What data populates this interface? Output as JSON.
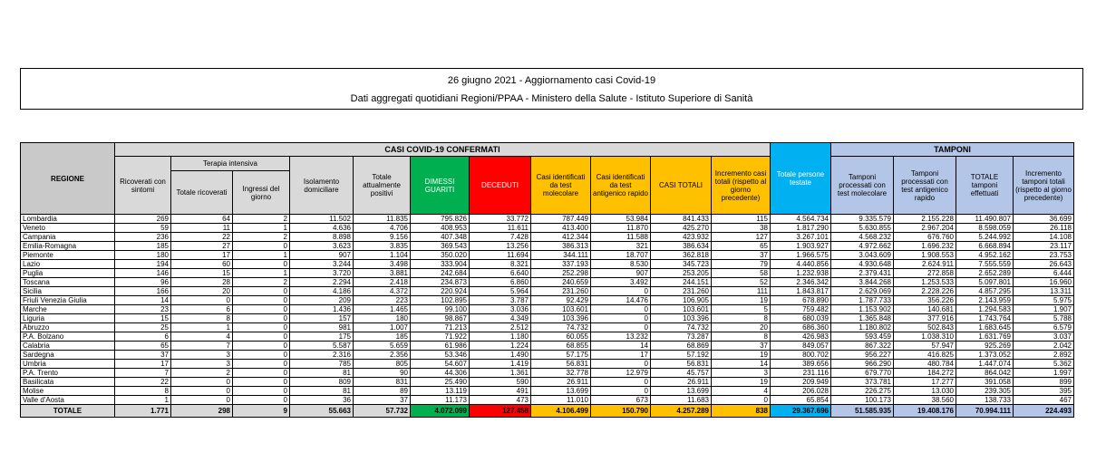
{
  "header": {
    "title": "26 giugno 2021 - Aggiornamento casi Covid-19",
    "subtitle": "Dati aggregati quotidiani Regioni/PPAA - Ministero della Salute - Istituto Superiore di Sanità"
  },
  "table": {
    "group_confirmed": "CASI COVID-19 CONFERMATI",
    "group_tamponi": "TAMPONI",
    "group_ti": "Terapia intensiva",
    "col_region": "REGIONE",
    "cols": [
      "Ricoverati con sintomi",
      "Totale ricoverati",
      "Ingressi del giorno",
      "Isolamento domiciliare",
      "Totale attualmente positivi",
      "DIMESSI GUARITI",
      "DECEDUTI",
      "Casi identificati da test molecolare",
      "Casi identificati da test antigenico rapido",
      "CASI TOTALI",
      "Incremento casi totali (rispetto al giorno precedente)",
      "Totale persone testate",
      "Tamponi processati con test molecolare",
      "Tamponi processati con test antigenico rapido",
      "TOTALE tamponi effettuati",
      "Incremento tamponi totali (rispetto al giorno precedente)"
    ],
    "rows": [
      [
        "Lombardia",
        "269",
        "64",
        "2",
        "11.502",
        "11.835",
        "795.826",
        "33.772",
        "787.449",
        "53.984",
        "841.433",
        "115",
        "4.564.734",
        "9.335.579",
        "2.155.228",
        "11.490.807",
        "36.699"
      ],
      [
        "Veneto",
        "59",
        "11",
        "1",
        "4.636",
        "4.706",
        "408.953",
        "11.611",
        "413.400",
        "11.870",
        "425.270",
        "38",
        "1.817.290",
        "5.630.855",
        "2.967.204",
        "8.598.059",
        "26.118"
      ],
      [
        "Campania",
        "236",
        "22",
        "2",
        "8.898",
        "9.156",
        "407.348",
        "7.428",
        "412.344",
        "11.588",
        "423.932",
        "127",
        "3.267.101",
        "4.568.232",
        "676.760",
        "5.244.992",
        "14.108"
      ],
      [
        "Emilia-Romagna",
        "185",
        "27",
        "0",
        "3.623",
        "3.835",
        "369.543",
        "13.256",
        "386.313",
        "321",
        "386.634",
        "65",
        "1.903.927",
        "4.972.662",
        "1.696.232",
        "6.668.894",
        "23.117"
      ],
      [
        "Piemonte",
        "180",
        "17",
        "1",
        "907",
        "1.104",
        "350.020",
        "11.694",
        "344.111",
        "18.707",
        "362.818",
        "37",
        "1.966.575",
        "3.043.609",
        "1.908.553",
        "4.952.162",
        "23.753"
      ],
      [
        "Lazio",
        "194",
        "60",
        "0",
        "3.244",
        "3.498",
        "333.904",
        "8.321",
        "337.193",
        "8.530",
        "345.723",
        "79",
        "4.440.856",
        "4.930.648",
        "2.624.911",
        "7.555.559",
        "26.643"
      ],
      [
        "Puglia",
        "146",
        "15",
        "1",
        "3.720",
        "3.881",
        "242.684",
        "6.640",
        "252.298",
        "907",
        "253.205",
        "58",
        "1.232.938",
        "2.379.431",
        "272.858",
        "2.652.289",
        "6.444"
      ],
      [
        "Toscana",
        "96",
        "28",
        "2",
        "2.294",
        "2.418",
        "234.873",
        "6.860",
        "240.659",
        "3.492",
        "244.151",
        "52",
        "2.346.342",
        "3.844.268",
        "1.253.533",
        "5.097.801",
        "16.960"
      ],
      [
        "Sicilia",
        "166",
        "20",
        "0",
        "4.186",
        "4.372",
        "220.924",
        "5.964",
        "231.260",
        "0",
        "231.260",
        "111",
        "1.843.817",
        "2.629.069",
        "2.228.226",
        "4.857.295",
        "13.311"
      ],
      [
        "Friuli Venezia Giulia",
        "14",
        "0",
        "0",
        "209",
        "223",
        "102.895",
        "3.787",
        "92.429",
        "14.476",
        "106.905",
        "19",
        "678.890",
        "1.787.733",
        "356.226",
        "2.143.959",
        "5.975"
      ],
      [
        "Marche",
        "23",
        "6",
        "0",
        "1.436",
        "1.465",
        "99.100",
        "3.036",
        "103.601",
        "0",
        "103.601",
        "5",
        "759.482",
        "1.153.902",
        "140.681",
        "1.294.583",
        "1.907"
      ],
      [
        "Liguria",
        "15",
        "8",
        "0",
        "157",
        "180",
        "98.867",
        "4.349",
        "103.396",
        "0",
        "103.396",
        "8",
        "680.039",
        "1.365.848",
        "377.916",
        "1.743.764",
        "5.788"
      ],
      [
        "Abruzzo",
        "25",
        "1",
        "0",
        "981",
        "1.007",
        "71.213",
        "2.512",
        "74.732",
        "0",
        "74.732",
        "20",
        "686.360",
        "1.180.802",
        "502.843",
        "1.683.645",
        "6.579"
      ],
      [
        "P.A. Bolzano",
        "6",
        "4",
        "0",
        "175",
        "185",
        "71.922",
        "1.180",
        "60.055",
        "13.232",
        "73.287",
        "8",
        "426.983",
        "593.459",
        "1.038.310",
        "1.631.769",
        "3.037"
      ],
      [
        "Calabria",
        "65",
        "7",
        "0",
        "5.587",
        "5.659",
        "61.986",
        "1.224",
        "68.855",
        "14",
        "68.869",
        "37",
        "849.057",
        "867.322",
        "57.947",
        "925.269",
        "2.042"
      ],
      [
        "Sardegna",
        "37",
        "3",
        "0",
        "2.316",
        "2.356",
        "53.346",
        "1.490",
        "57.175",
        "17",
        "57.192",
        "19",
        "800.702",
        "956.227",
        "416.825",
        "1.373.052",
        "2.892"
      ],
      [
        "Umbria",
        "17",
        "3",
        "0",
        "785",
        "805",
        "54.607",
        "1.419",
        "56.831",
        "0",
        "56.831",
        "14",
        "389.656",
        "966.290",
        "480.784",
        "1.447.074",
        "5.362"
      ],
      [
        "P.A. Trento",
        "7",
        "2",
        "0",
        "81",
        "90",
        "44.306",
        "1.361",
        "32.778",
        "12.979",
        "45.757",
        "3",
        "231.116",
        "679.770",
        "184.272",
        "864.042",
        "1.997"
      ],
      [
        "Basilicata",
        "22",
        "0",
        "0",
        "809",
        "831",
        "25.490",
        "590",
        "26.911",
        "0",
        "26.911",
        "19",
        "209.949",
        "373.781",
        "17.277",
        "391.058",
        "899"
      ],
      [
        "Molise",
        "8",
        "0",
        "0",
        "81",
        "89",
        "13.119",
        "491",
        "13.699",
        "0",
        "13.699",
        "4",
        "206.028",
        "226.275",
        "13.030",
        "239.305",
        "395"
      ],
      [
        "Valle d'Aosta",
        "1",
        "0",
        "0",
        "36",
        "37",
        "11.173",
        "473",
        "11.010",
        "673",
        "11.683",
        "0",
        "65.854",
        "100.173",
        "38.560",
        "138.733",
        "467"
      ]
    ],
    "totals": [
      "TOTALE",
      "1.771",
      "298",
      "9",
      "55.663",
      "57.732",
      "4.072.099",
      "127.458",
      "4.106.499",
      "150.790",
      "4.257.289",
      "838",
      "29.367.696",
      "51.585.935",
      "19.408.176",
      "70.994.111",
      "224.493"
    ]
  },
  "colors": {
    "header_gray": "#d9d9d9",
    "region_header": "#c9c9c9",
    "tamponi_blue": "#b4c6e7",
    "dimessi_green": "#00b050",
    "deceduti_red": "#ff0000",
    "casi_orange": "#ffc000",
    "persone_cyan": "#00b0f0"
  }
}
